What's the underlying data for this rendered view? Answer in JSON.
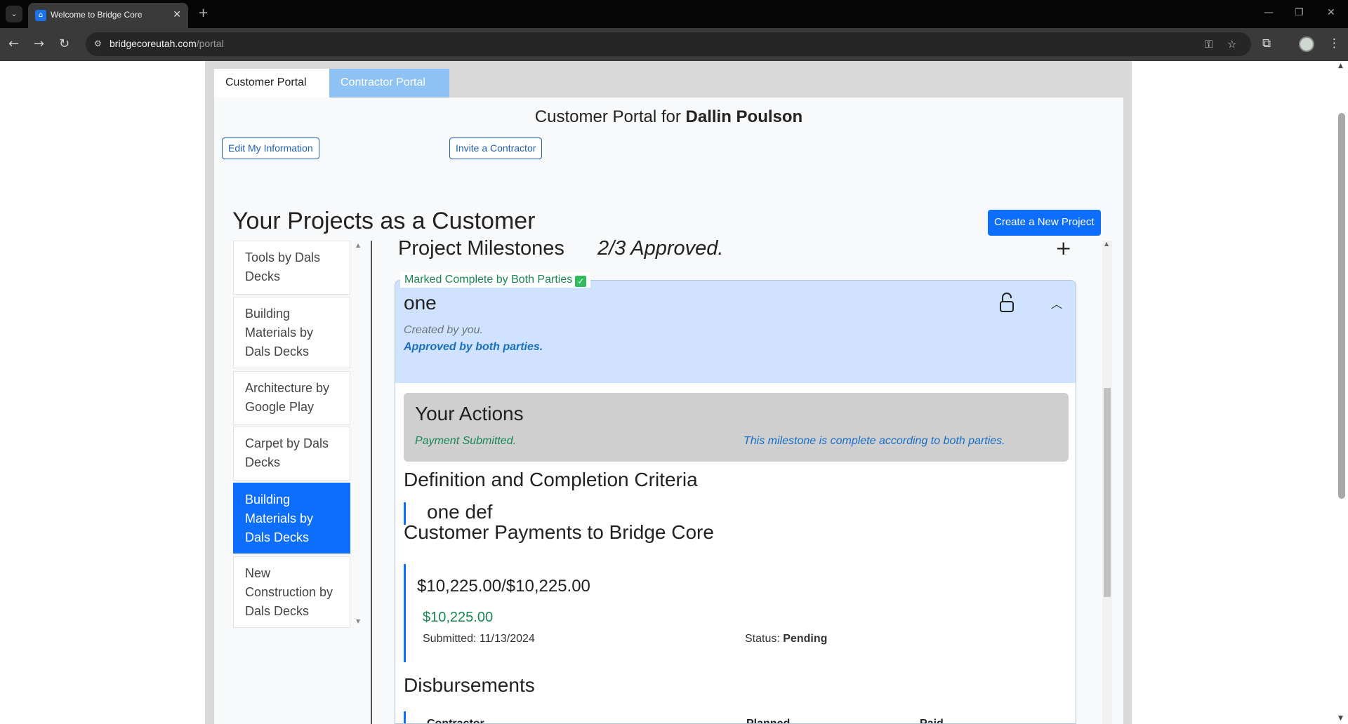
{
  "browser": {
    "tab_title": "Welcome to Bridge Core",
    "url_host": "bridgecoreutah.com",
    "url_path": "/portal"
  },
  "portal_tabs": {
    "customer": "Customer Portal",
    "contractor": "Contractor Portal"
  },
  "header": {
    "title_prefix": "Customer Portal for ",
    "customer_name": "Dallin Poulson",
    "edit_button": "Edit My Information",
    "invite_button": "Invite a Contractor"
  },
  "projects": {
    "heading": "Your Projects as a Customer",
    "create_button": "Create a New Project",
    "items": [
      {
        "label": "Tools by Dals Decks",
        "active": false
      },
      {
        "label": "Building Materials by Dals Decks",
        "active": false
      },
      {
        "label": "Architecture by Google Play",
        "active": false
      },
      {
        "label": "Carpet by Dals Decks",
        "active": false
      },
      {
        "label": "Building Materials by Dals Decks",
        "active": true
      },
      {
        "label": "New Construction by Dals Decks",
        "active": false
      }
    ]
  },
  "milestones": {
    "heading": "Project Milestones",
    "approved_summary": "2/3 Approved.",
    "add_icon": "plus-icon",
    "current": {
      "status_label": "Marked Complete by Both Parties",
      "name": "one",
      "created_by": "Created by you.",
      "approval": "Approved by both parties.",
      "lock_icon": "unlocked-padlock-icon",
      "collapse_icon": "chevron-up-icon"
    },
    "actions": {
      "title": "Your Actions",
      "payment_status": "Payment Submitted.",
      "completion_note": "This milestone is complete according to both parties."
    },
    "definition": {
      "heading": "Definition and Completion Criteria",
      "text": "one def"
    },
    "payments": {
      "heading": "Customer Payments to Bridge Core",
      "total": "$10,225.00/$10,225.00",
      "amount": "$10,225.00",
      "submitted": "Submitted: 11/13/2024",
      "status_label": "Status: ",
      "status_value": "Pending"
    },
    "disbursements": {
      "heading": "Disbursements",
      "columns": [
        "Contractor",
        "Planned",
        "Paid"
      ]
    }
  },
  "colors": {
    "primary": "#0d6efd",
    "success": "#198754",
    "header_bg": "#cfe2ff",
    "contractor_tab": "#8ec2f5"
  }
}
